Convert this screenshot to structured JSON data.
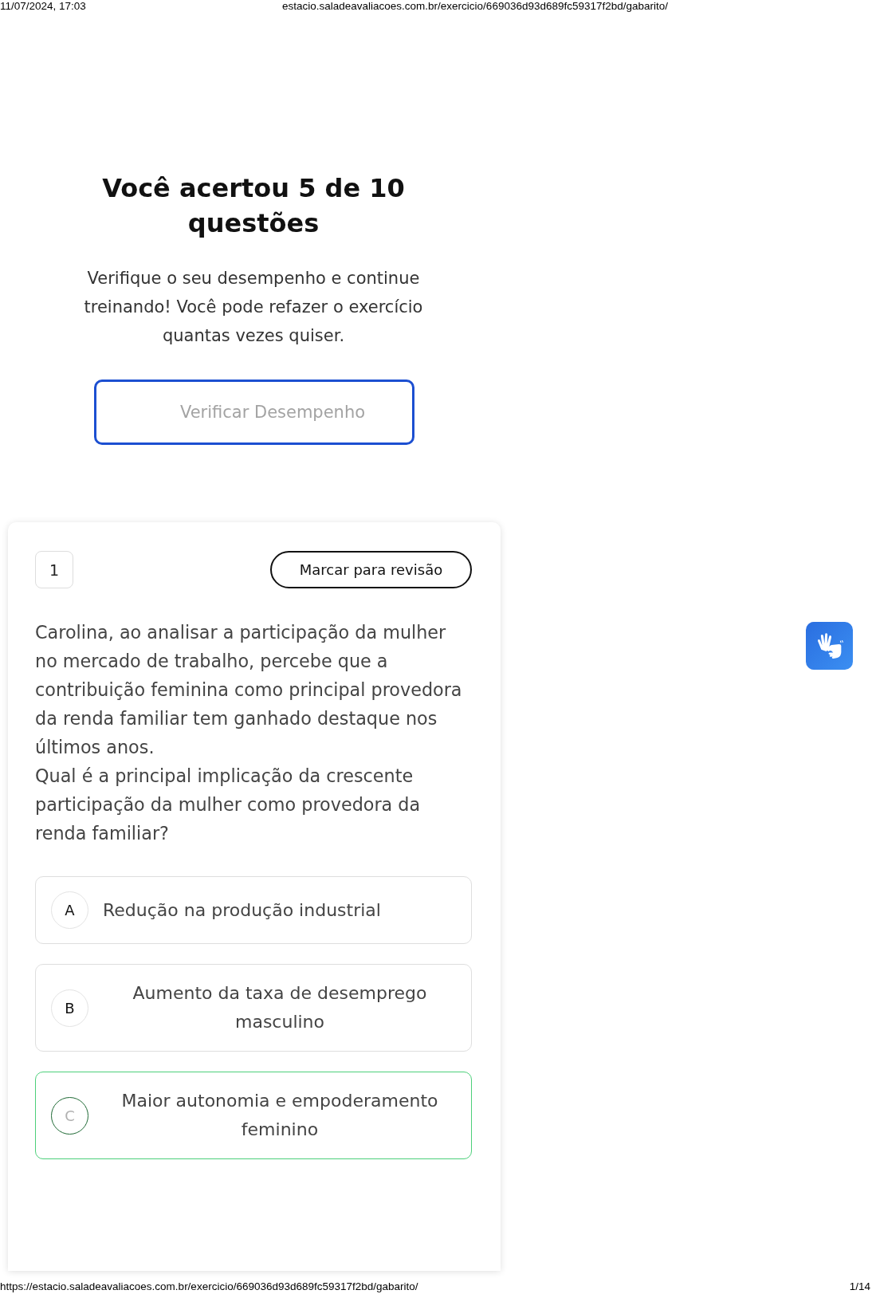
{
  "browser_header": {
    "date_time": "11/07/2024, 17:03",
    "url": "estacio.saladeavaliacoes.com.br/exercicio/669036d93d689fc59317f2bd/gabarito/"
  },
  "result": {
    "title": "Você acertou 5 de 10 questões",
    "message": "Verifique o seu desempenho e continue treinando! Você pode refazer o exercício quantas vezes quiser.",
    "button": "Verificar Desempenho"
  },
  "question": {
    "number": "1",
    "review_button": "Marcar para revisão",
    "paragraphs": [
      "Carolina, ao analisar a participação da mulher no mercado de trabalho, percebe que a contribuição feminina como principal provedora da renda familiar tem ganhado destaque nos últimos anos.",
      "Qual é a principal implicação da crescente participação da mulher como provedora da renda familiar?"
    ],
    "options": [
      {
        "letter": "A",
        "text": "Redução na produção industrial",
        "correct": false
      },
      {
        "letter": "B",
        "text": "Aumento da taxa de desemprego masculino",
        "correct": false
      },
      {
        "letter": "C",
        "text": "Maior autonomia e empoderamento feminino",
        "correct": true
      }
    ]
  },
  "footer": {
    "url": "https://estacio.saladeavaliacoes.com.br/exercicio/669036d93d689fc59317f2bd/gabarito/",
    "page": "1/14"
  }
}
